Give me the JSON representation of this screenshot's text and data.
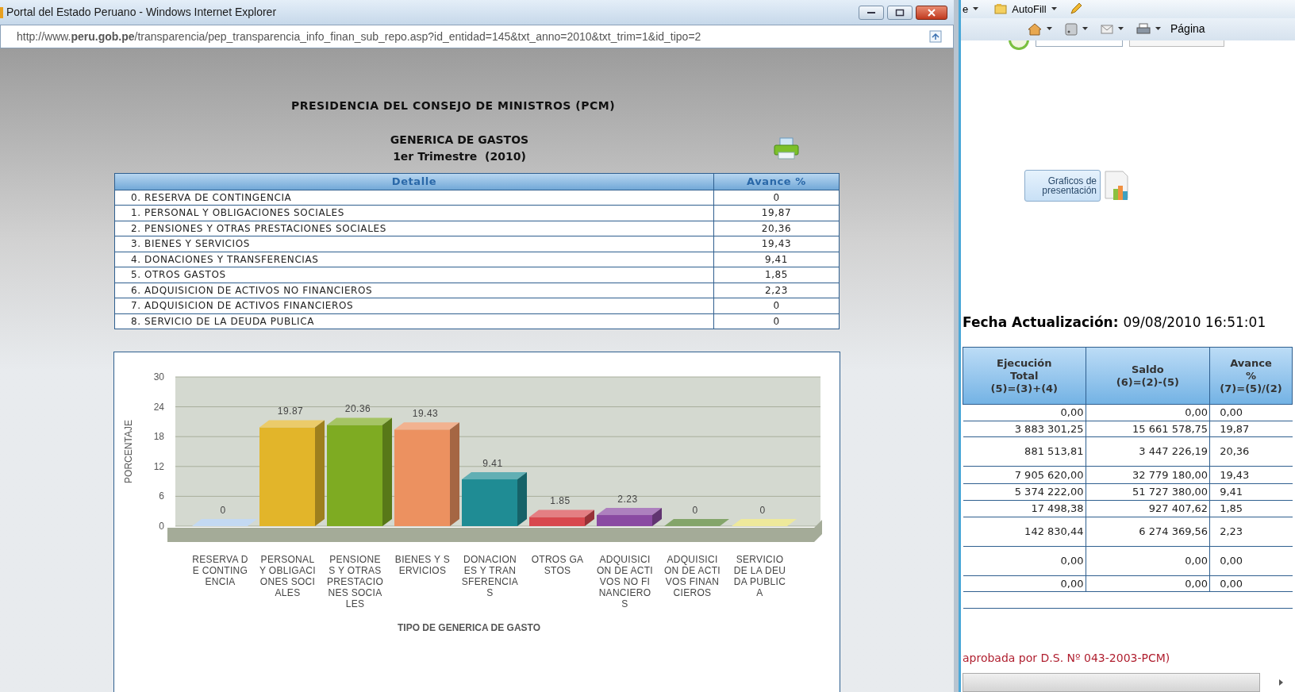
{
  "popup": {
    "title": "Portal del Estado Peruano - Windows Internet Explorer",
    "address": "http://www.**peru.gob.pe**/transparencia/pep_transparencia_info_finan_sub_repo.asp?id_entidad=145&txt_anno=2010&txt_trim=1&id_tipo=2",
    "heading": "PRESIDENCIA DEL CONSEJO DE MINISTROS (PCM)",
    "report_title": "GENERICA DE GASTOS",
    "report_period": "1er Trimestre  (2010)",
    "table": {
      "columns": [
        "Detalle",
        "Avance %"
      ],
      "rows": [
        {
          "detalle": "0. RESERVA DE CONTINGENCIA",
          "avance": "0"
        },
        {
          "detalle": "1. PERSONAL Y OBLIGACIONES SOCIALES",
          "avance": "19,87"
        },
        {
          "detalle": "2. PENSIONES Y OTRAS PRESTACIONES SOCIALES",
          "avance": "20,36"
        },
        {
          "detalle": "3. BIENES Y SERVICIOS",
          "avance": "19,43"
        },
        {
          "detalle": "4. DONACIONES Y TRANSFERENCIAS",
          "avance": "9,41"
        },
        {
          "detalle": "5. OTROS GASTOS",
          "avance": "1,85"
        },
        {
          "detalle": "6. ADQUISICION DE ACTIVOS NO FINANCIEROS",
          "avance": "2,23"
        },
        {
          "detalle": "7. ADQUISICION DE ACTIVOS FINANCIEROS",
          "avance": "0"
        },
        {
          "detalle": "8. SERVICIO DE LA DEUDA PUBLICA",
          "avance": "0"
        }
      ]
    },
    "chart_data": {
      "type": "bar",
      "xlabel": "TIPO DE GENERICA DE GASTO",
      "ylabel": "PORCENTAJE",
      "categories": [
        "RESERVA DE CONTINGENCIA",
        "PERSONAL Y OBLIGACIONES SOCIALES",
        "PENSIONES Y OTRAS PRESTACIONES SOCIALES",
        "BIENES Y SERVICIOS",
        "DONACIONES Y TRANSFERENCIAS",
        "OTROS GASTOS",
        "ADQUISICION DE ACTIVOS NO FINANCIEROS",
        "ADQUISICION DE ACTIVOS FINANCIEROS",
        "SERVICIO DE LA DEUDA PUBLICA"
      ],
      "values": [
        0,
        19.87,
        20.36,
        19.43,
        9.41,
        1.85,
        2.23,
        0,
        0
      ],
      "colors": [
        "#a9c9ec",
        "#e2b52a",
        "#7eab22",
        "#ec9160",
        "#1f8c94",
        "#d8484e",
        "#8a4aa2",
        "#4f7f2a",
        "#e6e070"
      ],
      "ylim": [
        0,
        30
      ],
      "yticks": [
        0,
        6,
        12,
        18,
        24,
        30
      ],
      "grid": true,
      "data_labels": true
    }
  },
  "background_window": {
    "toolbar_partial": "e",
    "autofill": "AutoFill",
    "page_menu": "Página",
    "charts_button": "Graficos de presentación",
    "update_label": "Fecha Actualización:",
    "update_value": "09/08/2010 16:51:01",
    "table": {
      "columns": [
        {
          "lines": [
            "Ejecución",
            "Total",
            "(5)=(3)+(4)"
          ]
        },
        {
          "lines": [
            "Saldo",
            "(6)=(2)-(5)"
          ]
        },
        {
          "lines": [
            "Avance",
            "%",
            "(7)=(5)/(2)"
          ]
        }
      ],
      "rows": [
        [
          "0,00",
          "0,00",
          "0,00"
        ],
        [
          "3 883 301,25",
          "15 661 578,75",
          "19,87"
        ],
        [
          "881 513,81",
          "3 447 226,19",
          "20,36"
        ],
        [
          "7 905 620,00",
          "32 779 180,00",
          "19,43"
        ],
        [
          "5 374 222,00",
          "51 727 380,00",
          "9,41"
        ],
        [
          "17 498,38",
          "927 407,62",
          "1,85"
        ],
        [
          "142 830,44",
          "6 274 369,56",
          "2,23"
        ],
        [
          "0,00",
          "0,00",
          "0,00"
        ],
        [
          "0,00",
          "0,00",
          "0,00"
        ]
      ]
    },
    "footnote": "aprobada por D.S. Nº 043-2003-PCM)"
  }
}
